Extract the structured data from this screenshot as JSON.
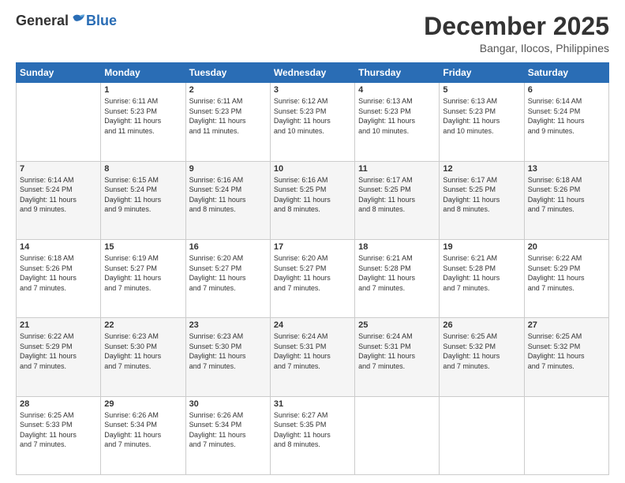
{
  "logo": {
    "general": "General",
    "blue": "Blue"
  },
  "title": "December 2025",
  "location": "Bangar, Ilocos, Philippines",
  "days_header": [
    "Sunday",
    "Monday",
    "Tuesday",
    "Wednesday",
    "Thursday",
    "Friday",
    "Saturday"
  ],
  "weeks": [
    [
      {
        "day": "",
        "info": ""
      },
      {
        "day": "1",
        "info": "Sunrise: 6:11 AM\nSunset: 5:23 PM\nDaylight: 11 hours\nand 11 minutes."
      },
      {
        "day": "2",
        "info": "Sunrise: 6:11 AM\nSunset: 5:23 PM\nDaylight: 11 hours\nand 11 minutes."
      },
      {
        "day": "3",
        "info": "Sunrise: 6:12 AM\nSunset: 5:23 PM\nDaylight: 11 hours\nand 10 minutes."
      },
      {
        "day": "4",
        "info": "Sunrise: 6:13 AM\nSunset: 5:23 PM\nDaylight: 11 hours\nand 10 minutes."
      },
      {
        "day": "5",
        "info": "Sunrise: 6:13 AM\nSunset: 5:23 PM\nDaylight: 11 hours\nand 10 minutes."
      },
      {
        "day": "6",
        "info": "Sunrise: 6:14 AM\nSunset: 5:24 PM\nDaylight: 11 hours\nand 9 minutes."
      }
    ],
    [
      {
        "day": "7",
        "info": "Sunrise: 6:14 AM\nSunset: 5:24 PM\nDaylight: 11 hours\nand 9 minutes."
      },
      {
        "day": "8",
        "info": "Sunrise: 6:15 AM\nSunset: 5:24 PM\nDaylight: 11 hours\nand 9 minutes."
      },
      {
        "day": "9",
        "info": "Sunrise: 6:16 AM\nSunset: 5:24 PM\nDaylight: 11 hours\nand 8 minutes."
      },
      {
        "day": "10",
        "info": "Sunrise: 6:16 AM\nSunset: 5:25 PM\nDaylight: 11 hours\nand 8 minutes."
      },
      {
        "day": "11",
        "info": "Sunrise: 6:17 AM\nSunset: 5:25 PM\nDaylight: 11 hours\nand 8 minutes."
      },
      {
        "day": "12",
        "info": "Sunrise: 6:17 AM\nSunset: 5:25 PM\nDaylight: 11 hours\nand 8 minutes."
      },
      {
        "day": "13",
        "info": "Sunrise: 6:18 AM\nSunset: 5:26 PM\nDaylight: 11 hours\nand 7 minutes."
      }
    ],
    [
      {
        "day": "14",
        "info": "Sunrise: 6:18 AM\nSunset: 5:26 PM\nDaylight: 11 hours\nand 7 minutes."
      },
      {
        "day": "15",
        "info": "Sunrise: 6:19 AM\nSunset: 5:27 PM\nDaylight: 11 hours\nand 7 minutes."
      },
      {
        "day": "16",
        "info": "Sunrise: 6:20 AM\nSunset: 5:27 PM\nDaylight: 11 hours\nand 7 minutes."
      },
      {
        "day": "17",
        "info": "Sunrise: 6:20 AM\nSunset: 5:27 PM\nDaylight: 11 hours\nand 7 minutes."
      },
      {
        "day": "18",
        "info": "Sunrise: 6:21 AM\nSunset: 5:28 PM\nDaylight: 11 hours\nand 7 minutes."
      },
      {
        "day": "19",
        "info": "Sunrise: 6:21 AM\nSunset: 5:28 PM\nDaylight: 11 hours\nand 7 minutes."
      },
      {
        "day": "20",
        "info": "Sunrise: 6:22 AM\nSunset: 5:29 PM\nDaylight: 11 hours\nand 7 minutes."
      }
    ],
    [
      {
        "day": "21",
        "info": "Sunrise: 6:22 AM\nSunset: 5:29 PM\nDaylight: 11 hours\nand 7 minutes."
      },
      {
        "day": "22",
        "info": "Sunrise: 6:23 AM\nSunset: 5:30 PM\nDaylight: 11 hours\nand 7 minutes."
      },
      {
        "day": "23",
        "info": "Sunrise: 6:23 AM\nSunset: 5:30 PM\nDaylight: 11 hours\nand 7 minutes."
      },
      {
        "day": "24",
        "info": "Sunrise: 6:24 AM\nSunset: 5:31 PM\nDaylight: 11 hours\nand 7 minutes."
      },
      {
        "day": "25",
        "info": "Sunrise: 6:24 AM\nSunset: 5:31 PM\nDaylight: 11 hours\nand 7 minutes."
      },
      {
        "day": "26",
        "info": "Sunrise: 6:25 AM\nSunset: 5:32 PM\nDaylight: 11 hours\nand 7 minutes."
      },
      {
        "day": "27",
        "info": "Sunrise: 6:25 AM\nSunset: 5:32 PM\nDaylight: 11 hours\nand 7 minutes."
      }
    ],
    [
      {
        "day": "28",
        "info": "Sunrise: 6:25 AM\nSunset: 5:33 PM\nDaylight: 11 hours\nand 7 minutes."
      },
      {
        "day": "29",
        "info": "Sunrise: 6:26 AM\nSunset: 5:34 PM\nDaylight: 11 hours\nand 7 minutes."
      },
      {
        "day": "30",
        "info": "Sunrise: 6:26 AM\nSunset: 5:34 PM\nDaylight: 11 hours\nand 7 minutes."
      },
      {
        "day": "31",
        "info": "Sunrise: 6:27 AM\nSunset: 5:35 PM\nDaylight: 11 hours\nand 8 minutes."
      },
      {
        "day": "",
        "info": ""
      },
      {
        "day": "",
        "info": ""
      },
      {
        "day": "",
        "info": ""
      }
    ]
  ]
}
